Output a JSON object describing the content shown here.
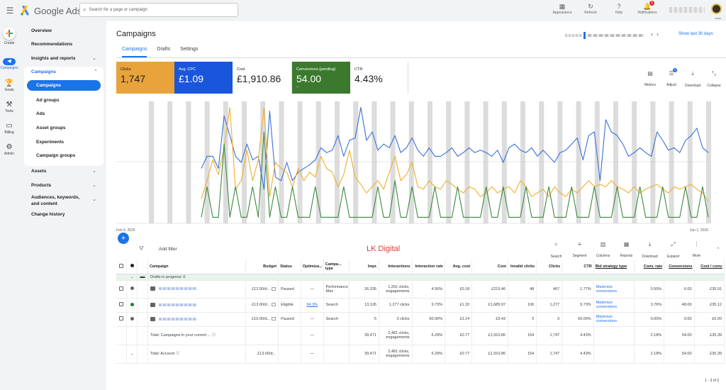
{
  "app": {
    "name": "Google Ads",
    "search_placeholder": "Search for a page or campaign",
    "account_label": "save"
  },
  "topbar": {
    "icons": [
      {
        "name": "appearance-icon",
        "glyph": "▦",
        "label": "Appearance"
      },
      {
        "name": "refresh-icon",
        "glyph": "↻",
        "label": "Refresh"
      },
      {
        "name": "help-icon",
        "glyph": "?",
        "label": "Help"
      },
      {
        "name": "notifications-icon",
        "glyph": "🔔",
        "label": "Notifications",
        "badge": "1"
      }
    ]
  },
  "rail": {
    "create": "Create",
    "items": [
      {
        "label": "Campaigns",
        "glyph": "◀"
      },
      {
        "label": "Goals",
        "glyph": "🏆"
      },
      {
        "label": "Tools",
        "glyph": "⚒"
      },
      {
        "label": "Billing",
        "glyph": "▭"
      },
      {
        "label": "Admin",
        "glyph": "⚙"
      }
    ]
  },
  "nav": {
    "top": [
      "Overview",
      "Recommendations",
      "Insights and reports"
    ],
    "campaigns_header": "Campaigns",
    "campaigns_sub": [
      "Campaigns",
      "Ad groups",
      "Ads",
      "Asset groups",
      "Experiments",
      "Campaign groups"
    ],
    "bottom": [
      "Assets",
      "Products",
      "Audiences, keywords, and content",
      "Change history"
    ]
  },
  "page": {
    "title": "Campaigns",
    "tabs": [
      "Campaigns",
      "Drafts",
      "Settings"
    ],
    "date_range": "Show last 30 days"
  },
  "metrics": [
    {
      "label": "Clicks",
      "value": "1,747",
      "bg": "#e8a33a",
      "fg": "#202124"
    },
    {
      "label": "Avg. CPC",
      "value": "£1.09",
      "bg": "#1a56db",
      "fg": "#ffffff"
    },
    {
      "label": "Cost",
      "value": "£1,910.86",
      "bg": "#ffffff",
      "fg": "#202124"
    },
    {
      "label": "Conversions (pending)",
      "value": "54.00",
      "sub": "--",
      "bg": "#3b7a2e",
      "fg": "#ffffff"
    },
    {
      "label": "CTR",
      "value": "4.43%",
      "bg": "#ffffff",
      "fg": "#202124"
    }
  ],
  "metric_tools": [
    {
      "label": "Metrics",
      "glyph": "▤"
    },
    {
      "label": "Adjust",
      "glyph": "☰",
      "badge": "3"
    },
    {
      "label": "Download",
      "glyph": "⤓"
    },
    {
      "label": "Collapse",
      "glyph": "⤡"
    }
  ],
  "chart_data": {
    "type": "line",
    "x_start": "Feb 4, 2026",
    "x_end": "Jun 1, 2026",
    "colors": {
      "blue": "#3b6fd8",
      "orange": "#f0ad2c",
      "green": "#3c8a3e"
    },
    "series": [
      {
        "values": [
          0.45,
          0.55,
          0.55,
          0.45,
          0.88,
          0.72,
          0.55,
          0.5,
          0.65,
          0.52,
          0.55,
          0.28,
          0.92,
          0.38,
          0.35,
          0.5,
          0.35,
          0.42,
          0.45,
          0.48,
          0.52,
          0.62,
          0.58,
          0.6,
          0.72,
          0.55,
          0.68,
          0.7,
          0.95,
          0.68,
          0.75,
          0.6,
          0.65,
          0.62,
          0.72,
          0.58,
          0.62,
          0.7,
          0.6,
          0.55,
          0.62,
          0.55,
          0.55,
          0.58,
          0.62,
          0.55,
          0.58,
          0.62,
          0.58,
          0.6,
          0.58,
          0.55,
          0.6,
          0.5,
          0.62,
          0.65,
          0.6,
          0.58,
          0.62,
          0.55,
          0.6,
          0.55,
          0.5,
          0.58,
          0.6,
          0.65,
          0.7,
          0.52,
          0.72,
          0.75,
          0.35,
          0.85,
          0.75,
          0.72,
          0.65,
          0.55,
          0.58,
          0.62,
          0.58,
          0.55,
          0.75,
          0.68,
          0.6,
          0.62,
          0.58,
          0.68,
          0.72,
          0.78,
          0.62,
          0.58
        ]
      },
      {
        "values": [
          0.2,
          0.35,
          0.52,
          0.4,
          0.62,
          0.95,
          0.28,
          0.35,
          0.6,
          0.35,
          0.52,
          0.95,
          0.22,
          0.5,
          0.45,
          0.42,
          0.3,
          0.45,
          0.35,
          0.42,
          0.38,
          0.55,
          0.45,
          0.42,
          0.3,
          0.4,
          0.6,
          0.38,
          0.32,
          0.25,
          0.3,
          0.35,
          0.28,
          0.42,
          0.55,
          0.35,
          0.4,
          0.5,
          0.3,
          0.28,
          0.35,
          0.3,
          0.28,
          0.35,
          0.32,
          0.28,
          0.25,
          0.3,
          0.28,
          0.22,
          0.25,
          0.3,
          0.25,
          0.28,
          0.3,
          0.25,
          0.35,
          0.3,
          0.22,
          0.25,
          0.28,
          0.22,
          0.3,
          0.25,
          0.22,
          0.28,
          0.25,
          0.3,
          0.35,
          0.3,
          0.32,
          0.3,
          0.35,
          0.3,
          0.28,
          0.25,
          0.3,
          0.25,
          0.28,
          0.3,
          0.32,
          0.28,
          0.25,
          0.3,
          0.28,
          0.3,
          0.32,
          0.28,
          0.25,
          0.18
        ]
      },
      {
        "values": [
          0.05,
          0.3,
          0.05,
          0.05,
          0.65,
          0.05,
          0.3,
          0.05,
          0.05,
          0.3,
          0.05,
          0.75,
          0.05,
          0.3,
          0.05,
          0.05,
          0.3,
          0.05,
          0.05,
          0.05,
          0.3,
          0.05,
          0.05,
          0.05,
          0.05,
          0.3,
          0.05,
          0.05,
          0.05,
          0.05,
          0.05,
          0.3,
          0.05,
          0.05,
          0.35,
          0.05,
          0.05,
          0.3,
          0.05,
          0.05,
          0.05,
          0.3,
          0.05,
          0.05,
          0.05,
          0.3,
          0.05,
          0.05,
          0.05,
          0.05,
          0.3,
          0.05,
          0.05,
          0.3,
          0.05,
          0.05,
          0.05,
          0.3,
          0.05,
          0.05,
          0.05,
          0.3,
          0.05,
          0.05,
          0.05,
          0.3,
          0.05,
          0.05,
          0.05,
          0.3,
          0.05,
          0.05,
          0.05,
          0.3,
          0.05,
          0.05,
          0.05,
          0.3,
          0.05,
          0.05,
          0.05,
          0.3,
          0.05,
          0.05,
          0.05,
          0.3,
          0.05,
          0.05,
          0.3,
          0.05
        ]
      }
    ]
  },
  "filter": {
    "add": "Add filter",
    "watermark": "LK Digital",
    "tools": [
      {
        "label": "Search",
        "glyph": "⌕"
      },
      {
        "label": "Segment",
        "glyph": "≡"
      },
      {
        "label": "Columns",
        "glyph": "▥"
      },
      {
        "label": "Reports",
        "glyph": "▦"
      },
      {
        "label": "Download",
        "glyph": "⤓"
      },
      {
        "label": "Expand",
        "glyph": "⤢"
      },
      {
        "label": "More",
        "glyph": "⋮"
      }
    ]
  },
  "table": {
    "headers": [
      "Campaign",
      "Budget",
      "Status",
      "Optimiza...",
      "Campa... type",
      "Impr.",
      "Interactions",
      "Interaction rate",
      "Avg. cost",
      "Cost",
      "Invalid clicks",
      "Clicks",
      "CTR",
      "Bid strategy type",
      "Conv. rate",
      "Conversions",
      "Cost / conv."
    ],
    "drafts": "Drafts in progress: 0",
    "rows": [
      {
        "budget": "£12.00/d...",
        "status": "Paused",
        "opt": "—",
        "type": "Performance Max",
        "impr": "26,335",
        "inter": "1,201 clicks, engagements",
        "irate": "4.56%",
        "avgcost": "£0.18",
        "cost": "£215.46",
        "invalid": "48",
        "clicks": "467",
        "ctr": "1.77%",
        "bid": "Maximize conversions",
        "convrate": "0.50%",
        "conv": "6.00",
        "cpc": "£35.91"
      },
      {
        "budget": "£13.00/d...",
        "status": "Eligible",
        "opt": "94.3%",
        "type": "Search",
        "impr": "13,126",
        "inter": "1,277 clicks",
        "irate": "9.73%",
        "avgcost": "£1.32",
        "cost": "£1,685.97",
        "invalid": "106",
        "clicks": "1,277",
        "ctr": "9.73%",
        "bid": "Maximize conversions",
        "convrate": "3.76%",
        "conv": "48.00",
        "cpc": "£35.12"
      },
      {
        "budget": "£10.00/d...",
        "status": "Paused",
        "opt": "—",
        "type": "Search",
        "impr": "5",
        "inter": "3 clicks",
        "irate": "60.00%",
        "avgcost": "£3.14",
        "cost": "£9.43",
        "invalid": "0",
        "clicks": "3",
        "ctr": "60.00%",
        "bid": "Maximize conversions",
        "convrate": "0.00%",
        "conv": "0.00",
        "cpc": "£0.00"
      }
    ],
    "total": {
      "label": "Total: Campaigns in your current ...",
      "opt": "—",
      "impr": "39,471",
      "inter": "2,481 clicks, engagements",
      "irate": "6.29%",
      "avgcost": "£0.77",
      "cost": "£1,910.86",
      "invalid": "154",
      "clicks": "1,747",
      "ctr": "4.43%",
      "convrate": "2.18%",
      "conv": "54.00",
      "cpc": "£35.39"
    },
    "account": {
      "label": "Total: Account",
      "budget": "£13.00/d...",
      "opt": "—",
      "impr": "39,471",
      "inter": "2,481 clicks, engagements",
      "irate": "6.29%",
      "avgcost": "£0.77",
      "cost": "£1,910.86",
      "invalid": "154",
      "clicks": "1,747",
      "ctr": "4.43%",
      "convrate": "2.18%",
      "conv": "54.00",
      "cpc": "£35.39"
    },
    "pager": "1 - 3 of 3"
  }
}
